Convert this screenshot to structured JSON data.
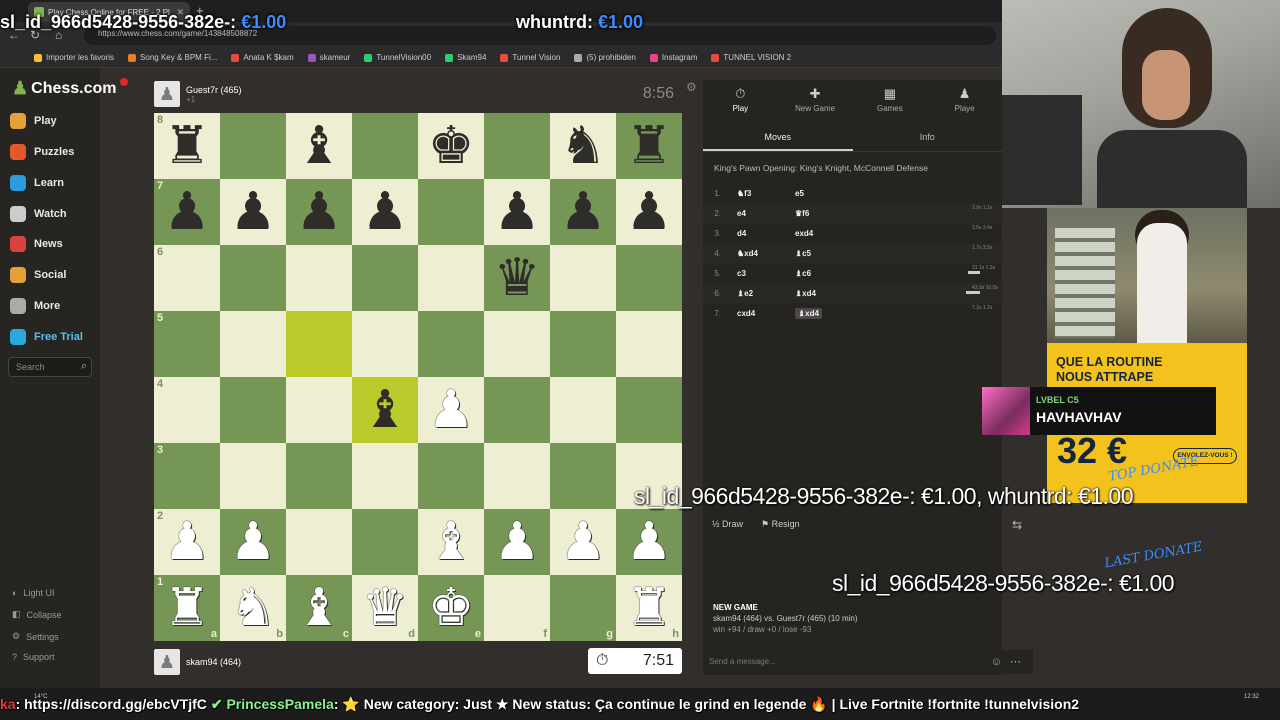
{
  "browser": {
    "tab_title": "Play Chess Online for FREE - 2 Pl",
    "url": "https://www.chess.com/game/143848508872",
    "bookmarks": [
      "Importer les favoris",
      "Song Key & BPM Fi...",
      "Anata K $kam",
      "skameur",
      "TunnelVision00",
      "Skam94",
      "Tunnel Vision",
      "(5) prohibiden",
      "Instagram",
      "TUNNEL VISION 2"
    ]
  },
  "sidebar": {
    "logo": "Chess.com",
    "logo_badge": "1",
    "items": [
      {
        "label": "Play",
        "icon": "play-hand-icon",
        "color": "#e6a03a"
      },
      {
        "label": "Puzzles",
        "icon": "puzzle-icon",
        "color": "#e5582a"
      },
      {
        "label": "Learn",
        "icon": "learn-icon",
        "color": "#2d9be0"
      },
      {
        "label": "Watch",
        "icon": "binoculars-icon",
        "color": "#cccccc"
      },
      {
        "label": "News",
        "icon": "news-icon",
        "color": "#d8433b"
      },
      {
        "label": "Social",
        "icon": "social-icon",
        "color": "#e6a03a"
      },
      {
        "label": "More",
        "icon": "more-dots-icon",
        "color": "#aaaaaa"
      },
      {
        "label": "Free Trial",
        "icon": "diamond-icon",
        "color": "#28a9e0"
      }
    ],
    "search_placeholder": "Search",
    "bottom": [
      "Light UI",
      "Collapse",
      "Settings",
      "Support"
    ]
  },
  "game": {
    "top_player": {
      "name": "Guest7r (465)",
      "sub": "+1"
    },
    "bottom_player": {
      "name": "skam94 (464)"
    },
    "top_clock": "8:56",
    "bottom_clock": "7:51",
    "ranks": [
      "8",
      "7",
      "6",
      "5",
      "4",
      "3",
      "2",
      "1"
    ],
    "files": [
      "a",
      "b",
      "c",
      "d",
      "e",
      "f",
      "g",
      "h"
    ],
    "board": [
      [
        "br",
        "",
        "bb",
        "",
        "bk",
        "",
        "bn",
        "br"
      ],
      [
        "bp",
        "bp",
        "bp",
        "bp",
        "",
        "bp",
        "bp",
        "bp"
      ],
      [
        "",
        "",
        "",
        "",
        "",
        "bq",
        "",
        ""
      ],
      [
        "",
        "",
        "",
        "",
        "",
        "",
        "",
        ""
      ],
      [
        "",
        "",
        "",
        "bb",
        "wp",
        "",
        "",
        ""
      ],
      [
        "",
        "",
        "",
        "",
        "",
        "",
        "",
        ""
      ],
      [
        "wp",
        "wp",
        "",
        "",
        "wb",
        "wp",
        "wp",
        "wp"
      ],
      [
        "wr",
        "wn",
        "wb",
        "wq",
        "wk",
        "",
        "",
        "wr"
      ]
    ],
    "highlight": [
      "c5",
      "d4"
    ]
  },
  "panel": {
    "tabs": [
      {
        "label": "Play",
        "glyph": "⏱"
      },
      {
        "label": "New Game",
        "glyph": "✚"
      },
      {
        "label": "Games",
        "glyph": "▦"
      },
      {
        "label": "Playe",
        "glyph": "♟"
      }
    ],
    "subtabs": [
      "Moves",
      "Info"
    ],
    "opening": "King's Pawn Opening: King's Knight, McConnell Defense",
    "moves": [
      {
        "n": "1.",
        "w": "♞f3",
        "b": "e5",
        "t": "",
        "bar": 0
      },
      {
        "n": "2.",
        "w": "e4",
        "b": "♛f6",
        "t": "2.9s 1.1s",
        "bar": 0
      },
      {
        "n": "3.",
        "w": "d4",
        "b": "exd4",
        "t": "3.5s 3.4s",
        "bar": 0
      },
      {
        "n": "4.",
        "w": "♞xd4",
        "b": "♝c5",
        "t": "1.7s 3.5s",
        "bar": 0
      },
      {
        "n": "5.",
        "w": "c3",
        "b": "♝c6",
        "t": "31.1s 1.3s",
        "bar": 12
      },
      {
        "n": "6.",
        "w": "♝e2",
        "b": "♝xd4",
        "t": "43.0s 10.0s",
        "bar": 14
      },
      {
        "n": "7.",
        "w": "cxd4",
        "b": "♝xd4",
        "t": "7.2s 1.2s",
        "bar": 0
      }
    ],
    "draw": "Draw",
    "resign": "Resign",
    "newgame_title": "NEW GAME",
    "newgame_line": "skam94 (464) vs. Guest7r (465) (10 min)",
    "newgame_stats": "win +94 / draw +0 / lose -93",
    "message_placeholder": "Send a message..."
  },
  "overlay": {
    "top_alert_1": {
      "name": "sl_id_966d5428-9556-382e-:",
      "amount": "€1.00"
    },
    "top_alert_2": {
      "name": "whuntrd:",
      "amount": "€1.00"
    },
    "ad_slogan_1": "QUE LA ROUTINE",
    "ad_slogan_2": "NOUS ATTRAPE",
    "ad_price": "32 €",
    "ad_button": "ENVOLEZ-VOUS !",
    "sub_level": "LVBEL C5",
    "sub_name": "HAVHAVHAV",
    "top_donate_label": "TOP DONATE",
    "last_donate_label": "LAST DONATE",
    "top_donations": "sl_id_966d5428-9556-382e-: €1.00, whuntrd: €1.00",
    "last_donation": "sl_id_966d5428-9556-382e-: €1.00"
  },
  "ticker": {
    "prefix": "ka",
    "text1": ": https://discord.gg/ebcVTjfC",
    "name": "PrincessPamela",
    "text2": ": ⭐ New category: Just  ★ New status: Ça continue le grind en legende 🔥 | Live Fortnite !fortnite !tunnelvision2"
  },
  "system": {
    "temp": "14°C",
    "clock": "12:32"
  }
}
